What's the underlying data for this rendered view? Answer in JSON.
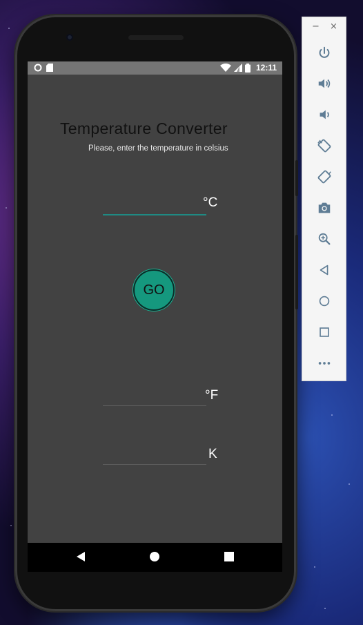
{
  "status_bar": {
    "time": "12:11",
    "icons": [
      "circle-notification-icon",
      "sd-card-icon",
      "wifi-icon",
      "cell-signal-icon",
      "battery-icon"
    ]
  },
  "app": {
    "title": "Temperature Converter",
    "subtitle": "Please, enter the temperature in celsius",
    "celsius_input": {
      "value": "",
      "unit": "°C"
    },
    "go_button_label": "GO",
    "fahrenheit_output": {
      "value": "",
      "unit": "°F"
    },
    "kelvin_output": {
      "value": "",
      "unit": "K"
    }
  },
  "nav_bar": {
    "buttons": [
      "back-icon",
      "home-icon",
      "recents-icon"
    ]
  },
  "emulator_toolbar": {
    "window_controls": {
      "minimize": "−",
      "close": "×"
    },
    "buttons": [
      "power-icon",
      "volume-up-icon",
      "volume-down-icon",
      "rotate-left-icon",
      "rotate-right-icon",
      "camera-icon",
      "zoom-icon",
      "back-icon",
      "home-icon",
      "overview-icon",
      "more-icon"
    ]
  },
  "colors": {
    "screen_bg": "#424242",
    "status_bar_bg": "#757575",
    "accent": "#1f8a83",
    "go_button": "#15987e",
    "toolbar_icon": "#5f7d95"
  }
}
